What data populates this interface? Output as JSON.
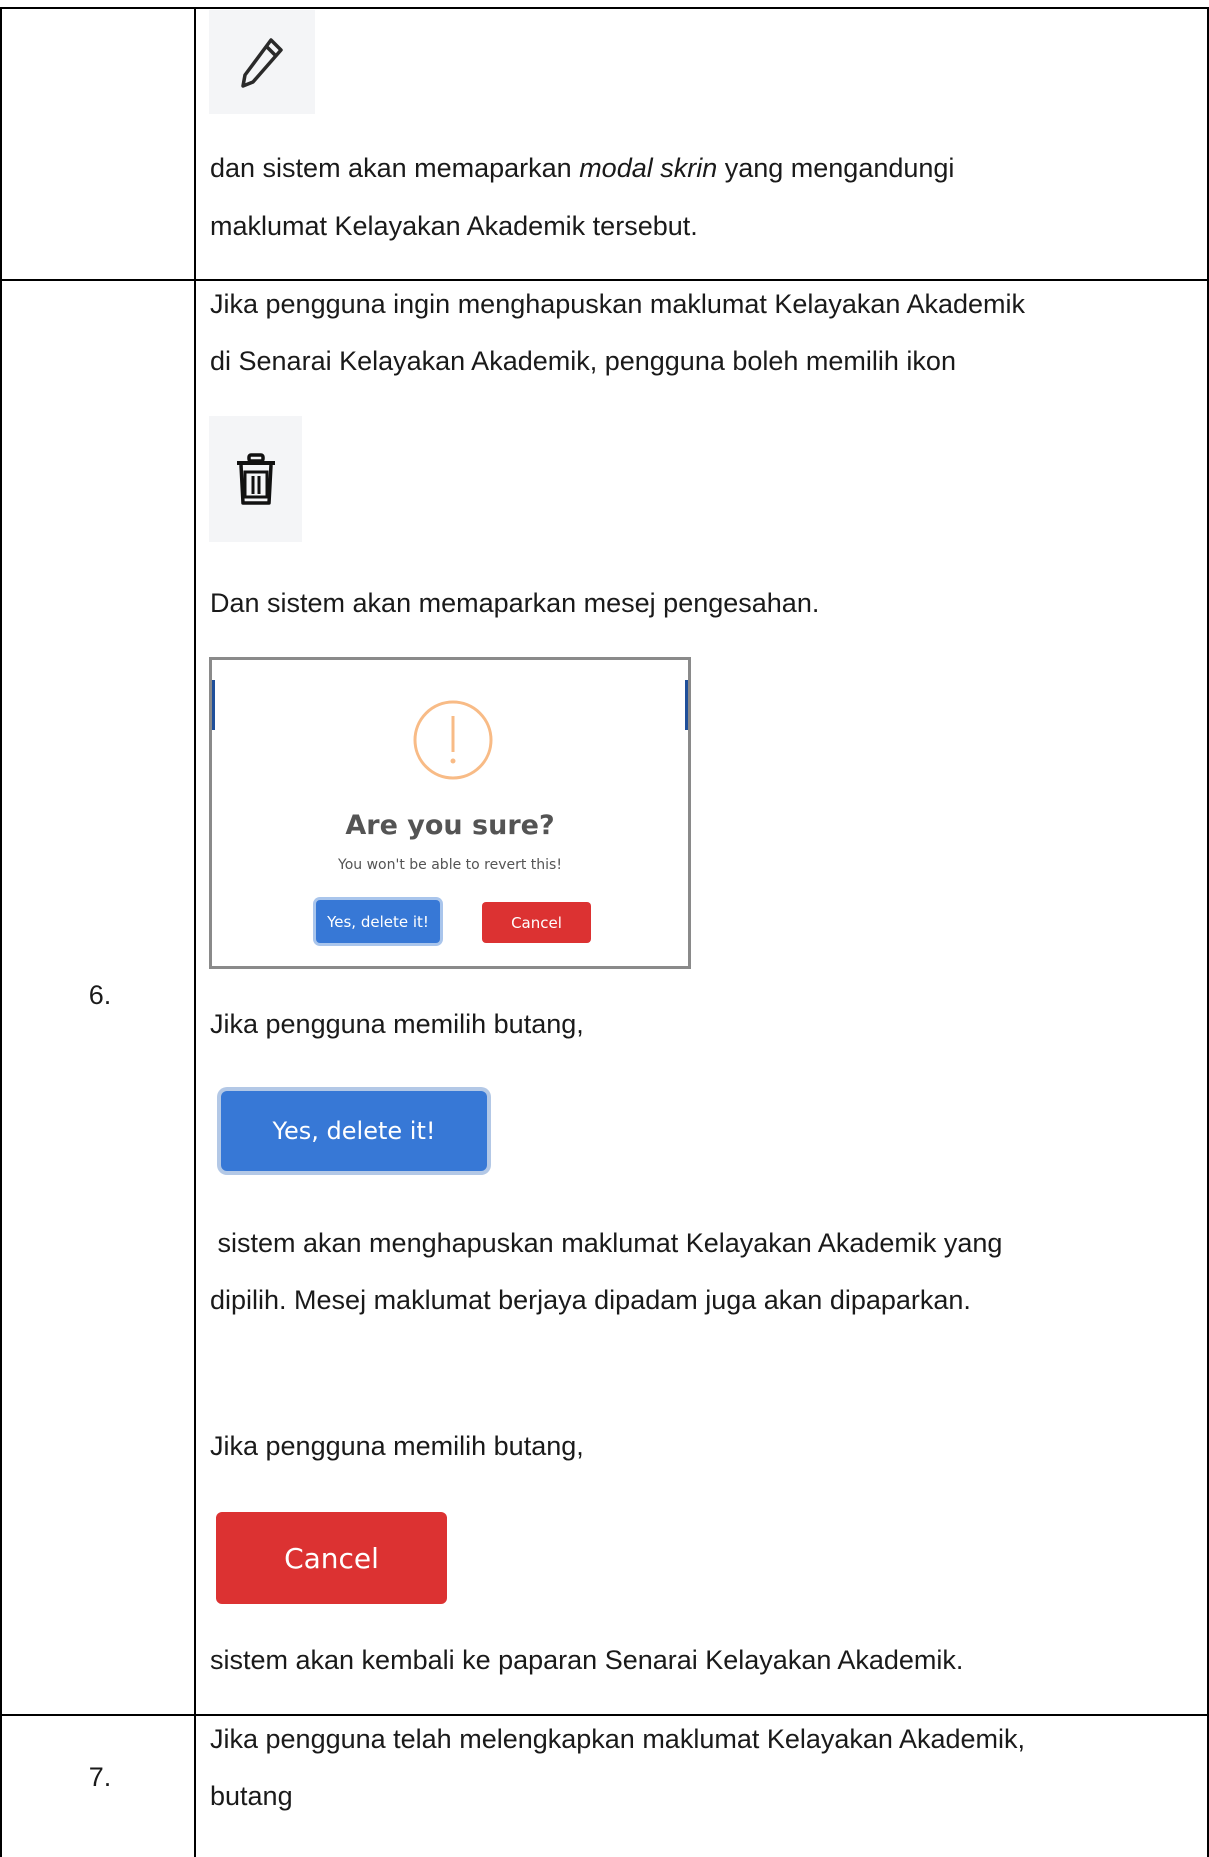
{
  "rows": {
    "row5": {
      "text_line1_a": "dan sistem akan memaparkan ",
      "text_line1_em": "modal skrin",
      "text_line1_b": " yang mengandungi",
      "text_line2": "maklumat Kelayakan Akademik tersebut.",
      "icon": "pencil-icon"
    },
    "row6": {
      "number": "6.",
      "intro_line1": "Jika pengguna ingin menghapuskan maklumat Kelayakan Akademik",
      "intro_line2": "di Senarai Kelayakan Akademik, pengguna boleh memilih ikon",
      "delete_icon": "trash-icon",
      "confirm_text": "Dan sistem akan memaparkan mesej pengesahan.",
      "dialog": {
        "warning_icon": "exclamation-icon",
        "title": "Are you sure?",
        "message": "You won't be able to revert this!",
        "confirm_label": "Yes, delete it!",
        "cancel_label": "Cancel"
      },
      "choose_button_1": "Jika pengguna memilih butang,",
      "yes_button_label": "Yes, delete it!",
      "yes_result_line1": " sistem akan menghapuskan maklumat Kelayakan Akademik yang",
      "yes_result_line2": "dipilih. Mesej maklumat berjaya dipadam juga akan dipaparkan.",
      "choose_button_2": "Jika pengguna memilih butang,",
      "cancel_button_label": "Cancel",
      "cancel_result": "sistem akan kembali ke paparan Senarai Kelayakan Akademik."
    },
    "row7": {
      "number": "7.",
      "text_line1": "Jika pengguna telah melengkapkan maklumat Kelayakan Akademik,",
      "text_line2": "butang"
    }
  },
  "colors": {
    "blue_button": "#3778d6",
    "red_button": "#dc3232",
    "warning": "#f8bb86"
  }
}
